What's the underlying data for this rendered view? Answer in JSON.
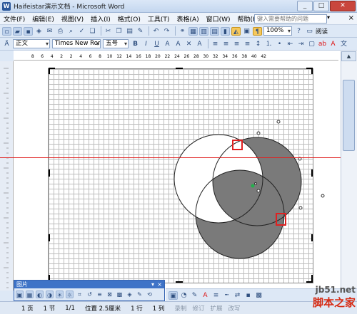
{
  "window": {
    "title": "Haifeistar演示文档 - Microsoft Word",
    "buttons": {
      "minimize": "_",
      "maximize": "□",
      "close": "✕"
    }
  },
  "menu": {
    "items": [
      "文件(F)",
      "编辑(E)",
      "视图(V)",
      "插入(I)",
      "格式(O)",
      "工具(T)",
      "表格(A)",
      "窗口(W)",
      "帮助(H)"
    ],
    "help_placeholder": "键入需要帮助的问题",
    "close_glyph": "×"
  },
  "format_toolbar": {
    "style": "正文",
    "font": "Times New Roman",
    "size": "五号",
    "zoom": "100%",
    "read_label": "阅读",
    "bold": "B",
    "italic": "I",
    "underline": "U"
  },
  "ruler": {
    "marks": [
      "8",
      "6",
      "4",
      "2",
      "2",
      "4",
      "6",
      "8",
      "10",
      "12",
      "14",
      "16",
      "18",
      "20",
      "22",
      "24",
      "26",
      "28",
      "30",
      "32",
      "34",
      "36",
      "38",
      "40",
      "42"
    ]
  },
  "picture_toolbar": {
    "title": "图片",
    "close_glyph": "×",
    "dropdown_glyph": "▾"
  },
  "statusbar": {
    "page": "1 页",
    "section": "1 节",
    "page_of": "1/1",
    "position": "位置 2.5厘米",
    "line": "1 行",
    "column": "1 列",
    "rec": "录制",
    "trk": "修订",
    "ext": "扩展",
    "ovr": "改写"
  },
  "watermark": {
    "site": "jb51.net",
    "name": "脚本之家"
  },
  "colors": {
    "accent_red": "#e02020",
    "circle_fill": "#7a7a7a",
    "titlebar": "#c4d7ef",
    "toolbar_blue": "#3e73c7"
  }
}
